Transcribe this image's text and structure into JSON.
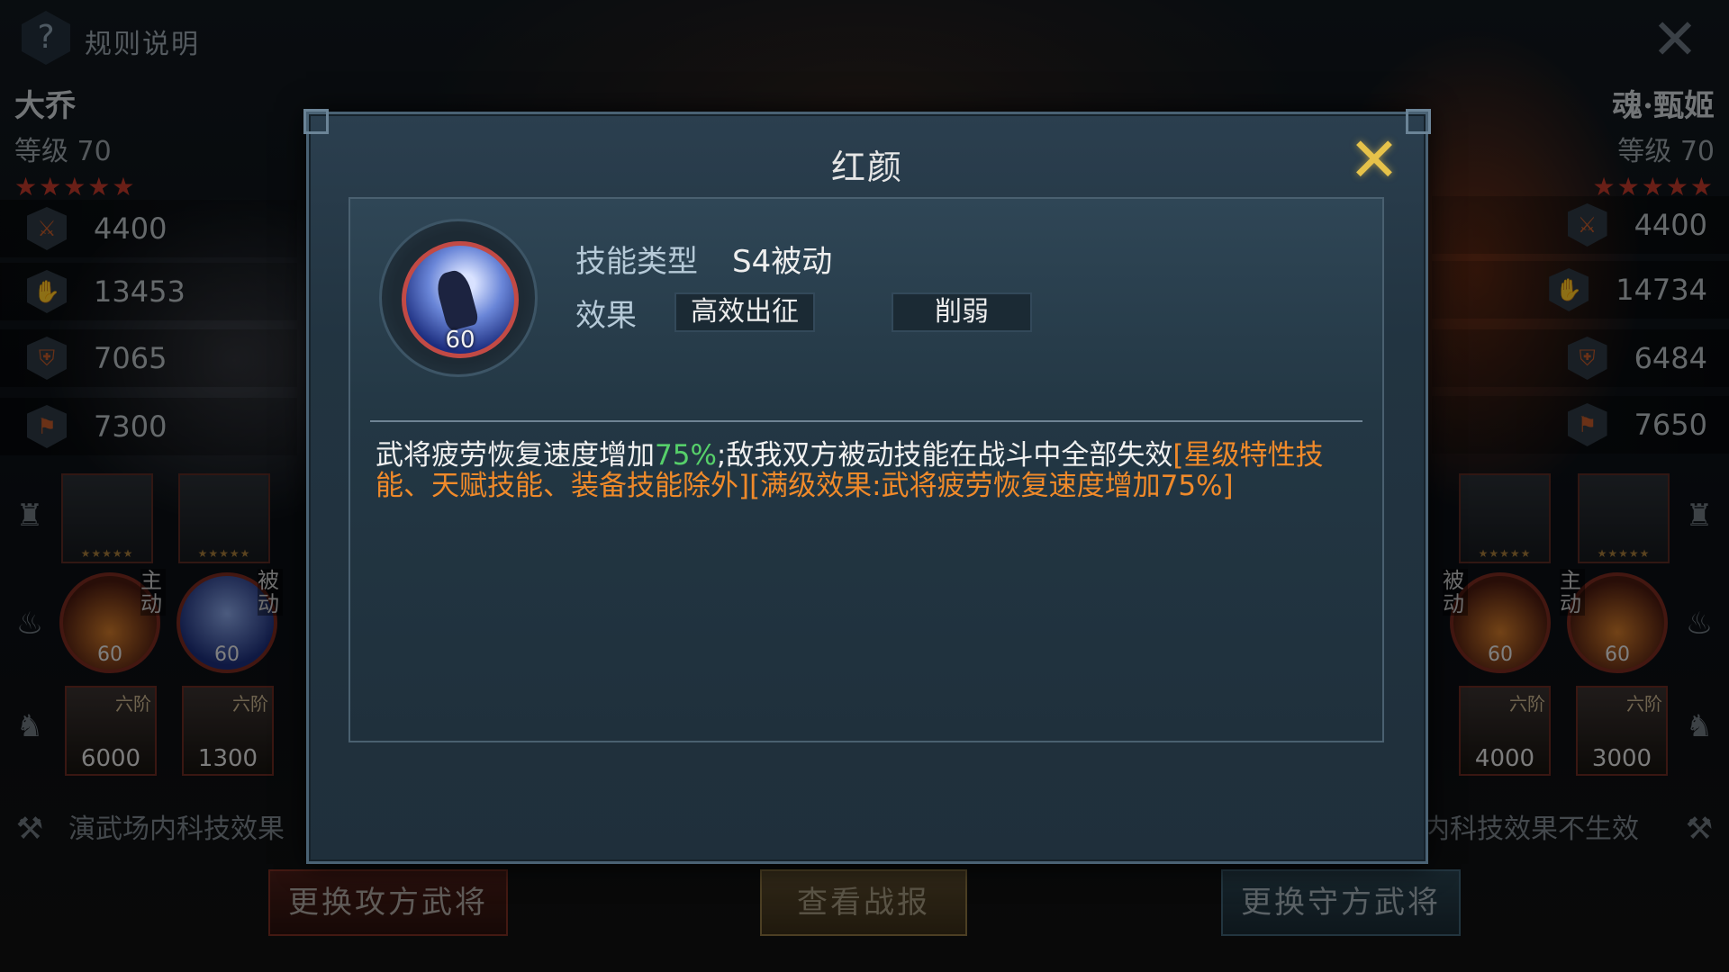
{
  "header": {
    "rules_label": "规则说明",
    "help_icon": "?"
  },
  "attacker": {
    "name": "大乔",
    "level_label": "等级",
    "level": "70",
    "stars": "★★★★★",
    "stats": [
      "4400",
      "13453",
      "7065",
      "7300"
    ],
    "skills": [
      {
        "level": "60",
        "tag": "主动"
      },
      {
        "level": "60",
        "tag": "被动"
      }
    ],
    "troops": [
      {
        "rank": "六阶",
        "count": "6000"
      },
      {
        "rank": "六阶",
        "count": "1300"
      }
    ],
    "tech_note": "演武场内科技效果"
  },
  "defender": {
    "name": "魂·甄姬",
    "level_label": "等级",
    "level": "70",
    "stars": "★★★★★",
    "stats": [
      "4400",
      "14734",
      "6484",
      "7650"
    ],
    "skills": [
      {
        "level": "60",
        "tag": "被动"
      },
      {
        "level": "60",
        "tag": "主动"
      }
    ],
    "troops": [
      {
        "rank": "六阶",
        "count": "4000"
      },
      {
        "rank": "六阶",
        "count": "3000"
      }
    ],
    "tech_note": "内科技效果不生效"
  },
  "buttons": {
    "attack": "更换攻方武将",
    "report": "查看战报",
    "defend": "更换守方武将"
  },
  "modal": {
    "title": "红颜",
    "skill_level": "60",
    "type_label": "技能类型",
    "type_value": "S4被动",
    "effect_label": "效果",
    "effect_tags": [
      "高效出征",
      "削弱"
    ],
    "desc_part1": "武将疲劳恢复速度增加",
    "desc_pct": "75%",
    "desc_part2": ";敌我双方被动技能在战斗中全部失效",
    "desc_orange": "[星级特性技能、天赋技能、装备技能除外][满级效果:武将疲劳恢复速度增加75%]"
  },
  "colors": {
    "green": "#56d06a",
    "orange": "#f08a2a",
    "close_gold": "#e6c24a"
  }
}
